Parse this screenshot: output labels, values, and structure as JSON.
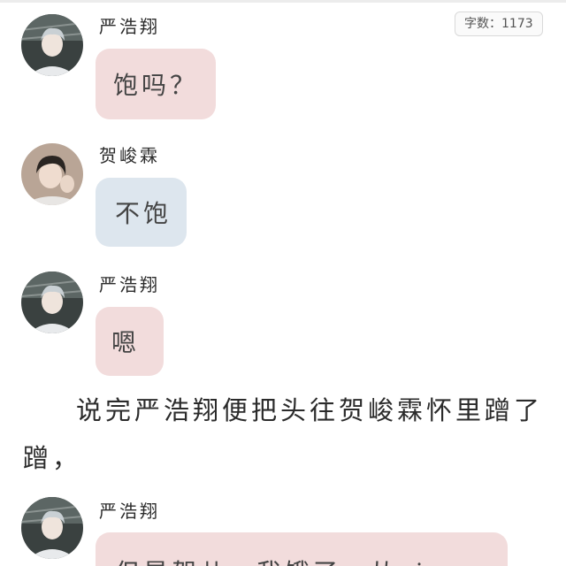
{
  "word_count": {
    "label": "字数：1173"
  },
  "colors": {
    "pink_bubble": "#f2dcdc",
    "blue_bubble": "#dde6ee",
    "text": "#333333"
  },
  "messages": [
    {
      "speaker": "严浩翔",
      "text": "饱吗？",
      "bubble": "pink",
      "avatar": "person-avatar-yan"
    },
    {
      "speaker": "贺峻霖",
      "text": "不饱",
      "bubble": "blue",
      "avatar": "person-avatar-he"
    },
    {
      "speaker": "严浩翔",
      "text": "嗯",
      "bubble": "pink",
      "avatar": "person-avatar-yan"
    },
    {
      "speaker": "严浩翔",
      "text": "但是贺儿，我饿了，从xi zao",
      "bubble": "pink",
      "avatar": "person-avatar-yan"
    }
  ],
  "narration": "说完严浩翔便把头往贺峻霖怀里蹭了蹭，"
}
